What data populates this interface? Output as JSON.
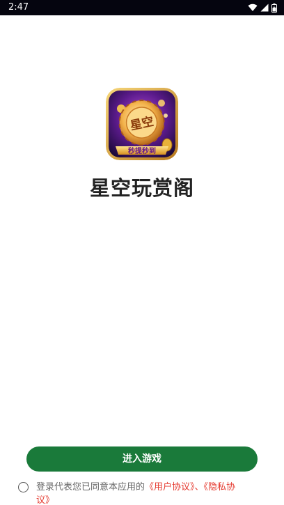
{
  "status_bar": {
    "time": "2:47",
    "icons": [
      "wifi-icon",
      "signal-icon",
      "battery-icon"
    ]
  },
  "app": {
    "icon_chip_text": "星空",
    "icon_banner_text": "秒提秒到",
    "name": "星空玩赏阁"
  },
  "main": {
    "enter_button_label": "进入游戏"
  },
  "agreement": {
    "prefix": "登录代表您已同意本应用的",
    "user_agreement_link": "《用户协议》",
    "separator": "、",
    "privacy_link": "《隐私协议》",
    "checked": false
  },
  "colors": {
    "status_bar_bg": "#05050f",
    "button_bg": "#1a7a3a",
    "link_color": "#e53a2f",
    "title_color": "#222222"
  }
}
